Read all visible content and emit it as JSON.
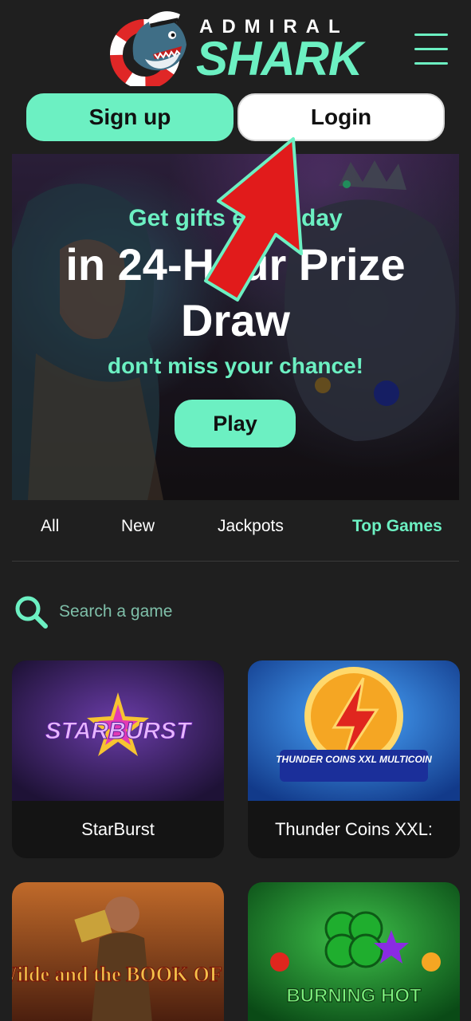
{
  "header": {
    "logo_top": "ADMIRAL",
    "logo_main": "SHARK",
    "menu_icon": "hamburger-menu-icon"
  },
  "auth": {
    "signup_label": "Sign up",
    "login_label": "Login"
  },
  "banner": {
    "line1": "Get gifts every day",
    "line2": "in 24-Hour Prize",
    "line3": "Draw",
    "line4": "don't miss your chance!",
    "play_label": "Play"
  },
  "tabs": [
    {
      "label": "All"
    },
    {
      "label": "New"
    },
    {
      "label": "Jackpots"
    },
    {
      "label": "Top Games",
      "active": true
    }
  ],
  "search": {
    "placeholder": "Search a game",
    "icon": "search-icon"
  },
  "games": [
    {
      "title": "StarBurst",
      "thumb_label": "STARBURST"
    },
    {
      "title": "Thunder Coins XXL:",
      "thumb_label": "THUNDER COINS XXL MULTICOIN"
    },
    {
      "title": "",
      "thumb_label": "Rich Wilde and the BOOK OF DEAD"
    },
    {
      "title": "",
      "thumb_label": "BURNING HOT"
    }
  ],
  "colors": {
    "accent": "#6cf0c2",
    "background": "#1f1f1f",
    "card": "#141414",
    "arrow": "#e11b1b"
  }
}
